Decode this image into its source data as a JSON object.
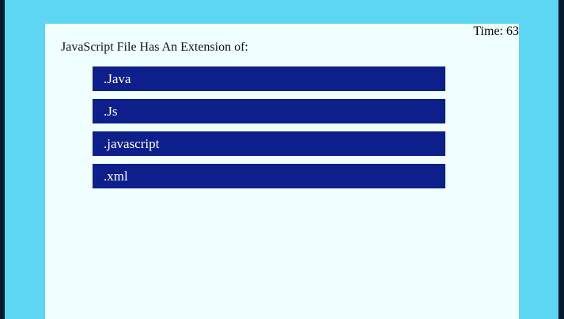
{
  "quiz": {
    "timer_label": "Time: 63",
    "question": "JavaScript File Has An Extension of:",
    "options": [
      {
        "label": ".Java"
      },
      {
        "label": ".Js"
      },
      {
        "label": ".javascript"
      },
      {
        "label": ".xml"
      }
    ]
  },
  "colors": {
    "page_frame": "#5dd6f4",
    "card_background": "#f0ffff",
    "option_background": "#0d1f8a",
    "option_text": "#ffffff"
  }
}
